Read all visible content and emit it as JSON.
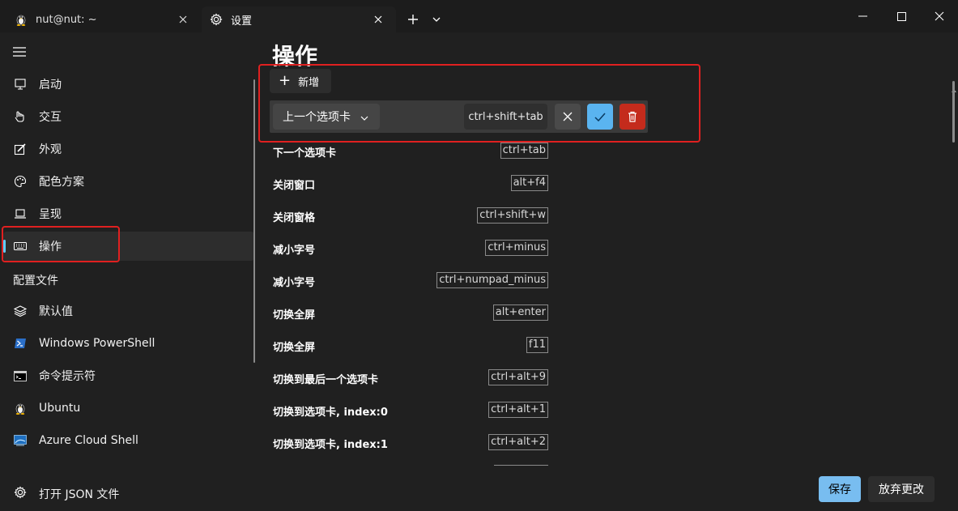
{
  "tabs": [
    {
      "label": "nut@nut: ~",
      "icon": "linux-penguin-icon"
    },
    {
      "label": "设置",
      "icon": "gear-icon"
    }
  ],
  "sidebar": {
    "items": [
      {
        "label": "启动",
        "icon": "startup-icon"
      },
      {
        "label": "交互",
        "icon": "interaction-icon"
      },
      {
        "label": "外观",
        "icon": "appearance-icon"
      },
      {
        "label": "配色方案",
        "icon": "palette-icon"
      },
      {
        "label": "呈现",
        "icon": "rendering-icon"
      },
      {
        "label": "操作",
        "icon": "keyboard-icon"
      }
    ],
    "profiles_header": "配置文件",
    "profiles": [
      {
        "label": "默认值",
        "icon": "layers-icon"
      },
      {
        "label": "Windows PowerShell",
        "icon": "powershell-icon"
      },
      {
        "label": "命令提示符",
        "icon": "cmd-icon"
      },
      {
        "label": "Ubuntu",
        "icon": "linux-penguin-icon"
      },
      {
        "label": "Azure Cloud Shell",
        "icon": "azure-icon"
      }
    ],
    "open_json": "打开 JSON 文件"
  },
  "main": {
    "title": "操作",
    "add_button": "新增",
    "edit_row": {
      "action": "上一个选项卡",
      "keys": "ctrl+shift+tab"
    },
    "actions": [
      {
        "name": "下一个选项卡",
        "keys": "ctrl+tab"
      },
      {
        "name": "关闭窗口",
        "keys": "alt+f4"
      },
      {
        "name": "关闭窗格",
        "keys": "ctrl+shift+w"
      },
      {
        "name": "减小字号",
        "keys": "ctrl+minus"
      },
      {
        "name": "减小字号",
        "keys": "ctrl+numpad_minus"
      },
      {
        "name": "切换全屏",
        "keys": "alt+enter"
      },
      {
        "name": "切换全屏",
        "keys": "f11"
      },
      {
        "name": "切换到最后一个选项卡",
        "keys": "ctrl+alt+9"
      },
      {
        "name": "切换到选项卡, index:0",
        "keys": "ctrl+alt+1"
      },
      {
        "name": "切换到选项卡, index:1",
        "keys": "ctrl+alt+2"
      }
    ]
  },
  "footer": {
    "save": "保存",
    "discard": "放弃更改"
  },
  "colors": {
    "accent": "#60cdff",
    "save_button": "#78bdf0",
    "delete_button": "#c42b1c",
    "highlight_box": "#e02020"
  }
}
